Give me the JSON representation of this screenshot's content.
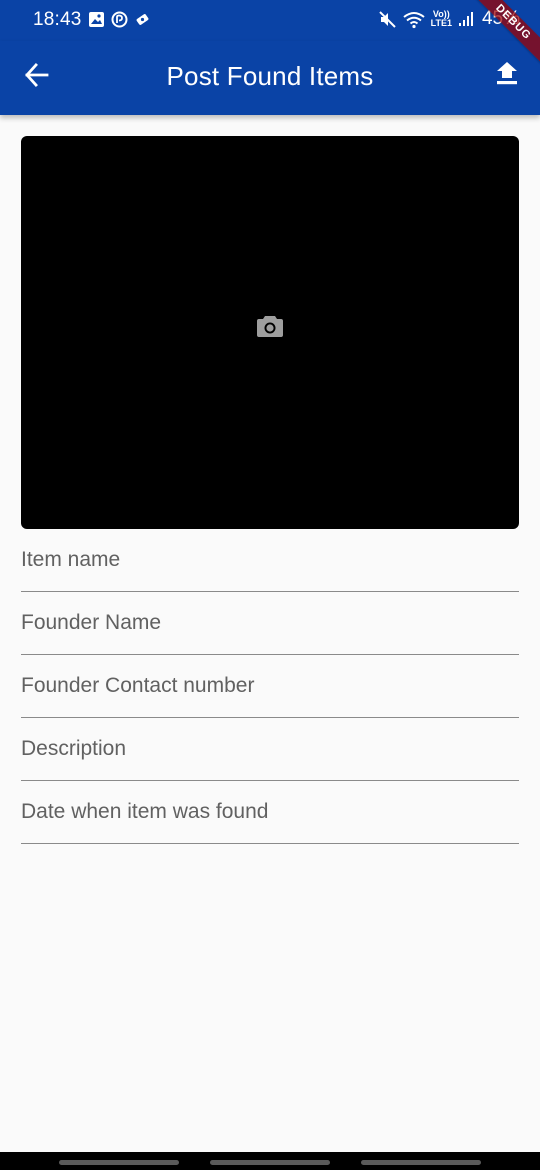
{
  "status_bar": {
    "time": "18:43",
    "lte_line1": "Vo))",
    "lte_line2": "LTE1",
    "battery": "45%",
    "debug_label": "DEBUG"
  },
  "app_bar": {
    "title": "Post Found Items",
    "back_icon": "arrow-back-icon",
    "upload_icon": "upload-icon",
    "background_color": "#0a43a6"
  },
  "image_picker": {
    "icon": "camera-icon"
  },
  "form": {
    "fields": [
      {
        "label": "Item name"
      },
      {
        "label": "Founder Name"
      },
      {
        "label": "Founder Contact number"
      },
      {
        "label": "Description"
      },
      {
        "label": "Date when item was found"
      }
    ]
  }
}
